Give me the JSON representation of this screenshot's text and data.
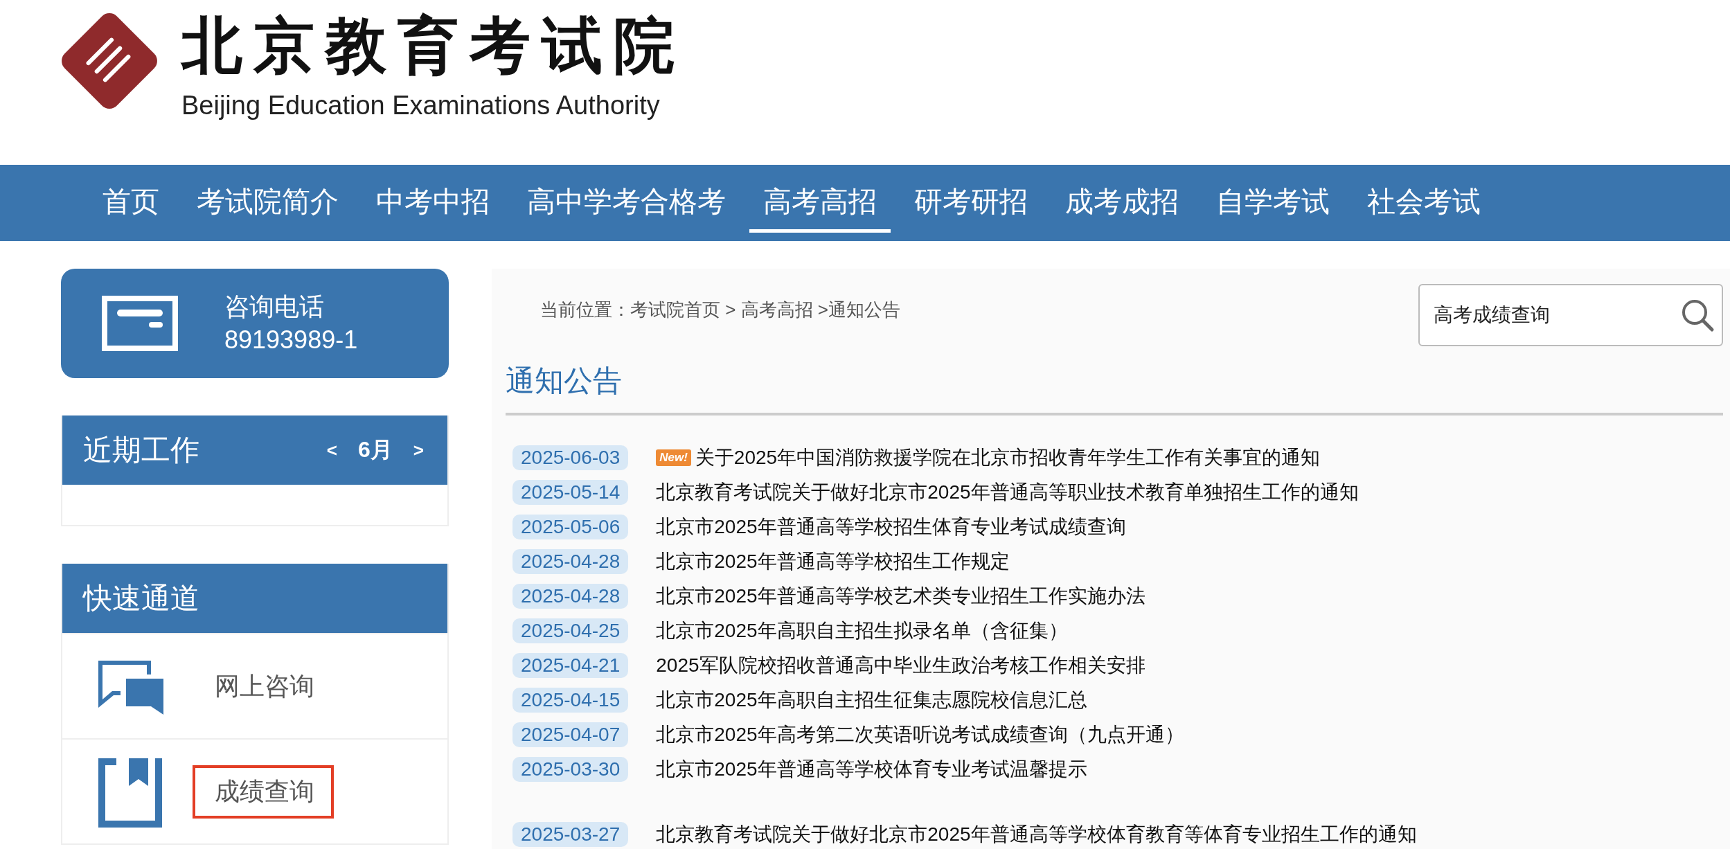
{
  "header": {
    "title": "北京教育考试院",
    "subtitle": "Beijing Education Examinations Authority"
  },
  "nav": [
    {
      "label": "首页",
      "selected": false
    },
    {
      "label": "考试院简介",
      "selected": false
    },
    {
      "label": "中考中招",
      "selected": false
    },
    {
      "label": "高中学考合格考",
      "selected": false
    },
    {
      "label": "高考高招",
      "selected": true
    },
    {
      "label": "研考研招",
      "selected": false
    },
    {
      "label": "成考成招",
      "selected": false
    },
    {
      "label": "自学考试",
      "selected": false
    },
    {
      "label": "社会考试",
      "selected": false
    }
  ],
  "hotline": {
    "label": "咨询电话",
    "number": "89193989-1"
  },
  "recent_work": {
    "title": "近期工作",
    "prev": "<",
    "month": "6月",
    "next": ">"
  },
  "quick_links": {
    "title": "快速通道",
    "items": [
      {
        "kind": "chat",
        "label": "网上咨询",
        "highlighted": false
      },
      {
        "kind": "bookmark",
        "label": "成绩查询",
        "highlighted": true
      }
    ]
  },
  "breadcrumb": "当前位置：考试院首页 > 高考高招 >通知公告",
  "search": {
    "value": "高考成绩查询"
  },
  "section_title": "通知公告",
  "notice_groups": [
    {
      "items": [
        {
          "date": "2025-06-03",
          "badge": "New!",
          "title": "关于2025年中国消防救援学院在北京市招收青年学生工作有关事宜的通知"
        },
        {
          "date": "2025-05-14",
          "title": "北京教育考试院关于做好北京市2025年普通高等职业技术教育单独招生工作的通知"
        },
        {
          "date": "2025-05-06",
          "title": "北京市2025年普通高等学校招生体育专业考试成绩查询"
        },
        {
          "date": "2025-04-28",
          "title": "北京市2025年普通高等学校招生工作规定"
        },
        {
          "date": "2025-04-28",
          "title": "北京市2025年普通高等学校艺术类专业招生工作实施办法"
        },
        {
          "date": "2025-04-25",
          "title": "北京市2025年高职自主招生拟录名单（含征集）"
        },
        {
          "date": "2025-04-21",
          "title": "2025军队院校招收普通高中毕业生政治考核工作相关安排"
        },
        {
          "date": "2025-04-15",
          "title": "北京市2025年高职自主招生征集志愿院校信息汇总"
        },
        {
          "date": "2025-04-07",
          "title": "北京市2025年高考第二次英语听说考试成绩查询（九点开通）"
        },
        {
          "date": "2025-03-30",
          "title": "北京市2025年普通高等学校体育专业考试温馨提示"
        }
      ]
    },
    {
      "items": [
        {
          "date": "2025-03-27",
          "title": "北京教育考试院关于做好北京市2025年普通高等学校体育教育等体育专业招生工作的通知"
        }
      ]
    }
  ]
}
